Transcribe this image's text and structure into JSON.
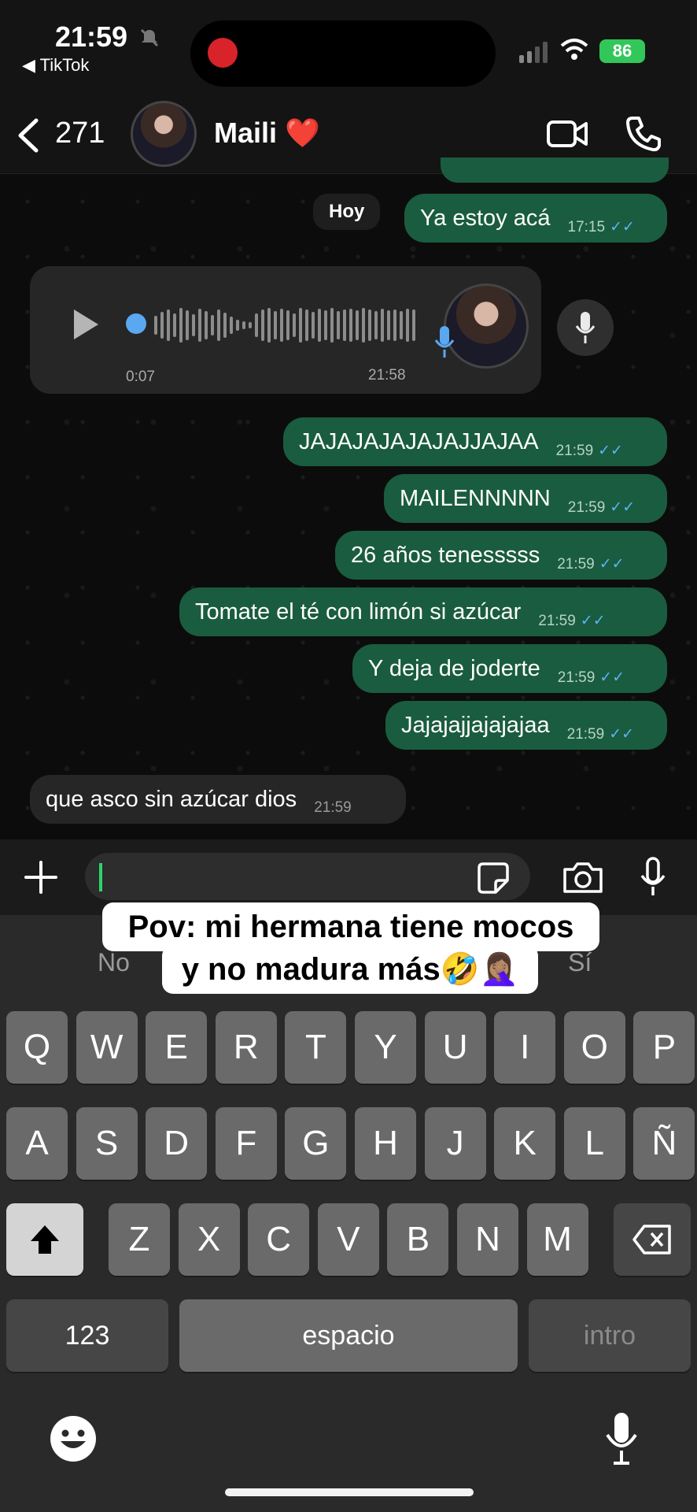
{
  "status_bar": {
    "time": "21:59",
    "back_app": "◀ TikTok",
    "battery": "86"
  },
  "header": {
    "unread_count": "271",
    "contact_name": "Maili",
    "heart": "❤️"
  },
  "chat": {
    "date_chip": "Hoy",
    "first_out": {
      "text": "Ya estoy acá",
      "time": "17:15"
    },
    "voice_note": {
      "elapsed": "0:07",
      "time": "21:58"
    },
    "outgoing": [
      {
        "text": "JAJAJAJAJAJAJJAJAA",
        "time": "21:59"
      },
      {
        "text": "MAILENNNNN",
        "time": "21:59"
      },
      {
        "text": "26 años tenesssss",
        "time": "21:59"
      },
      {
        "text": "Tomate el té con limón si azúcar",
        "time": "21:59"
      },
      {
        "text": "Y deja de joderte",
        "time": "21:59"
      },
      {
        "text": "Jajajajjajajajaa",
        "time": "21:59"
      }
    ],
    "incoming": {
      "text": "que asco sin azúcar dios",
      "time": "21:59"
    }
  },
  "overlay_caption": {
    "line1": "Pov: mi hermana tiene mocos",
    "line2": "y no madura más🤣🤦🏽‍♀️"
  },
  "keyboard": {
    "suggestions": [
      "No",
      "Sí"
    ],
    "row1": [
      "Q",
      "W",
      "E",
      "R",
      "T",
      "Y",
      "U",
      "I",
      "O",
      "P"
    ],
    "row2": [
      "A",
      "S",
      "D",
      "F",
      "G",
      "H",
      "J",
      "K",
      "L",
      "Ñ"
    ],
    "row3": [
      "Z",
      "X",
      "C",
      "V",
      "B",
      "N",
      "M"
    ],
    "numbers_key": "123",
    "space_key": "espacio",
    "return_key": "intro"
  },
  "colors": {
    "outgoing_bubble": "#1a5c3f",
    "incoming_bubble": "#262626",
    "read_ticks": "#5db4f4",
    "caret": "#2cd56a"
  }
}
